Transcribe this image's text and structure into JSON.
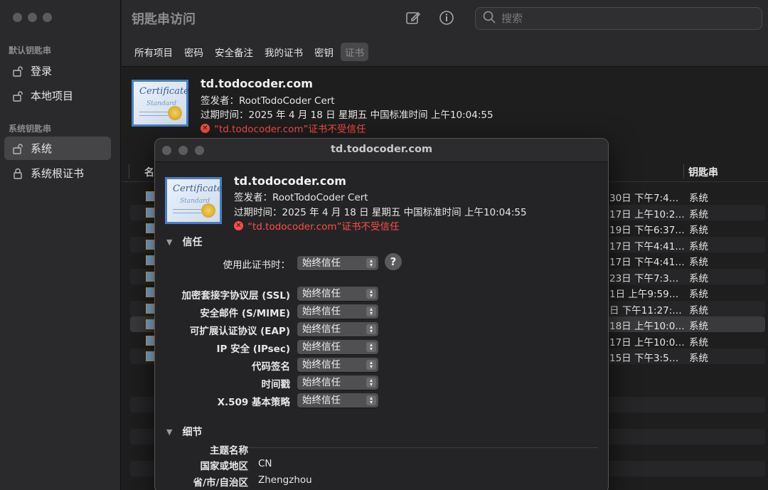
{
  "sidebar": {
    "section_default": "默认钥匙串",
    "section_system": "系统钥匙串",
    "items": [
      {
        "label": "登录",
        "icon": "unlock-icon"
      },
      {
        "label": "本地项目",
        "icon": "unlock-icon"
      },
      {
        "label": "系统",
        "icon": "unlock-icon",
        "selected": true
      },
      {
        "label": "系统根证书",
        "icon": "lock-icon"
      }
    ]
  },
  "toolbar": {
    "title": "钥匙串访问",
    "search_placeholder": "搜索"
  },
  "tabs": [
    "所有项目",
    "密码",
    "安全备注",
    "我的证书",
    "密钥",
    "证书"
  ],
  "header_cert": {
    "name": "td.todocoder.com",
    "issuer": "签发者：RootTodoCoder Cert",
    "expires": "过期时间：2025 年 4 月 18 日 星期五 中国标准时间 上午10:04:55",
    "error": "“td.todocoder.com”证书不受信任",
    "img_title": "Certificate",
    "img_sub": "Standard"
  },
  "table": {
    "col_name": "名",
    "col_keychain": "钥匙串",
    "rows": [
      {
        "date": "30日 下午7:4…",
        "keychain": "系统"
      },
      {
        "date": "17日 上午10:2…",
        "keychain": "系统"
      },
      {
        "date": "19日 下午6:37…",
        "keychain": "系统"
      },
      {
        "date": "17日 下午4:41…",
        "keychain": "系统"
      },
      {
        "date": "17日 下午4:41…",
        "keychain": "系统"
      },
      {
        "date": "23日 下午7:3…",
        "keychain": "系统"
      },
      {
        "date": "1日 上午9:59…",
        "keychain": "系统"
      },
      {
        "date": "日 下午11:27:…",
        "keychain": "系统"
      },
      {
        "date": "18日 上午10:0…",
        "keychain": "系统"
      },
      {
        "date": "17日 上午10:0…",
        "keychain": "系统"
      },
      {
        "date": "15日 下午3:5…",
        "keychain": "系统"
      }
    ]
  },
  "dialog": {
    "title": "td.todocoder.com",
    "cert_name": "td.todocoder.com",
    "issuer": "签发者：RootTodoCoder Cert",
    "expires": "过期时间：2025 年 4 月 18 日 星期五 中国标准时间 上午10:04:55",
    "error": "“td.todocoder.com”证书不受信任",
    "trust_section": "信任",
    "use_label": "使用此证书时：",
    "use_value": "始终信任",
    "help": "?",
    "policies": [
      {
        "label": "加密套接字协议层 (SSL)",
        "value": "始终信任"
      },
      {
        "label": "安全邮件 (S/MIME)",
        "value": "始终信任"
      },
      {
        "label": "可扩展认证协议 (EAP)",
        "value": "始终信任"
      },
      {
        "label": "IP 安全 (IPsec)",
        "value": "始终信任"
      },
      {
        "label": "代码签名",
        "value": "始终信任"
      },
      {
        "label": "时间戳",
        "value": "始终信任"
      },
      {
        "label": "X.509 基本策略",
        "value": "始终信任"
      }
    ],
    "details_section": "细节",
    "subject_name": "主题名称",
    "details": [
      {
        "label": "国家或地区",
        "value": "CN"
      },
      {
        "label": "省/市/自治区",
        "value": "Zhengzhou"
      }
    ]
  }
}
